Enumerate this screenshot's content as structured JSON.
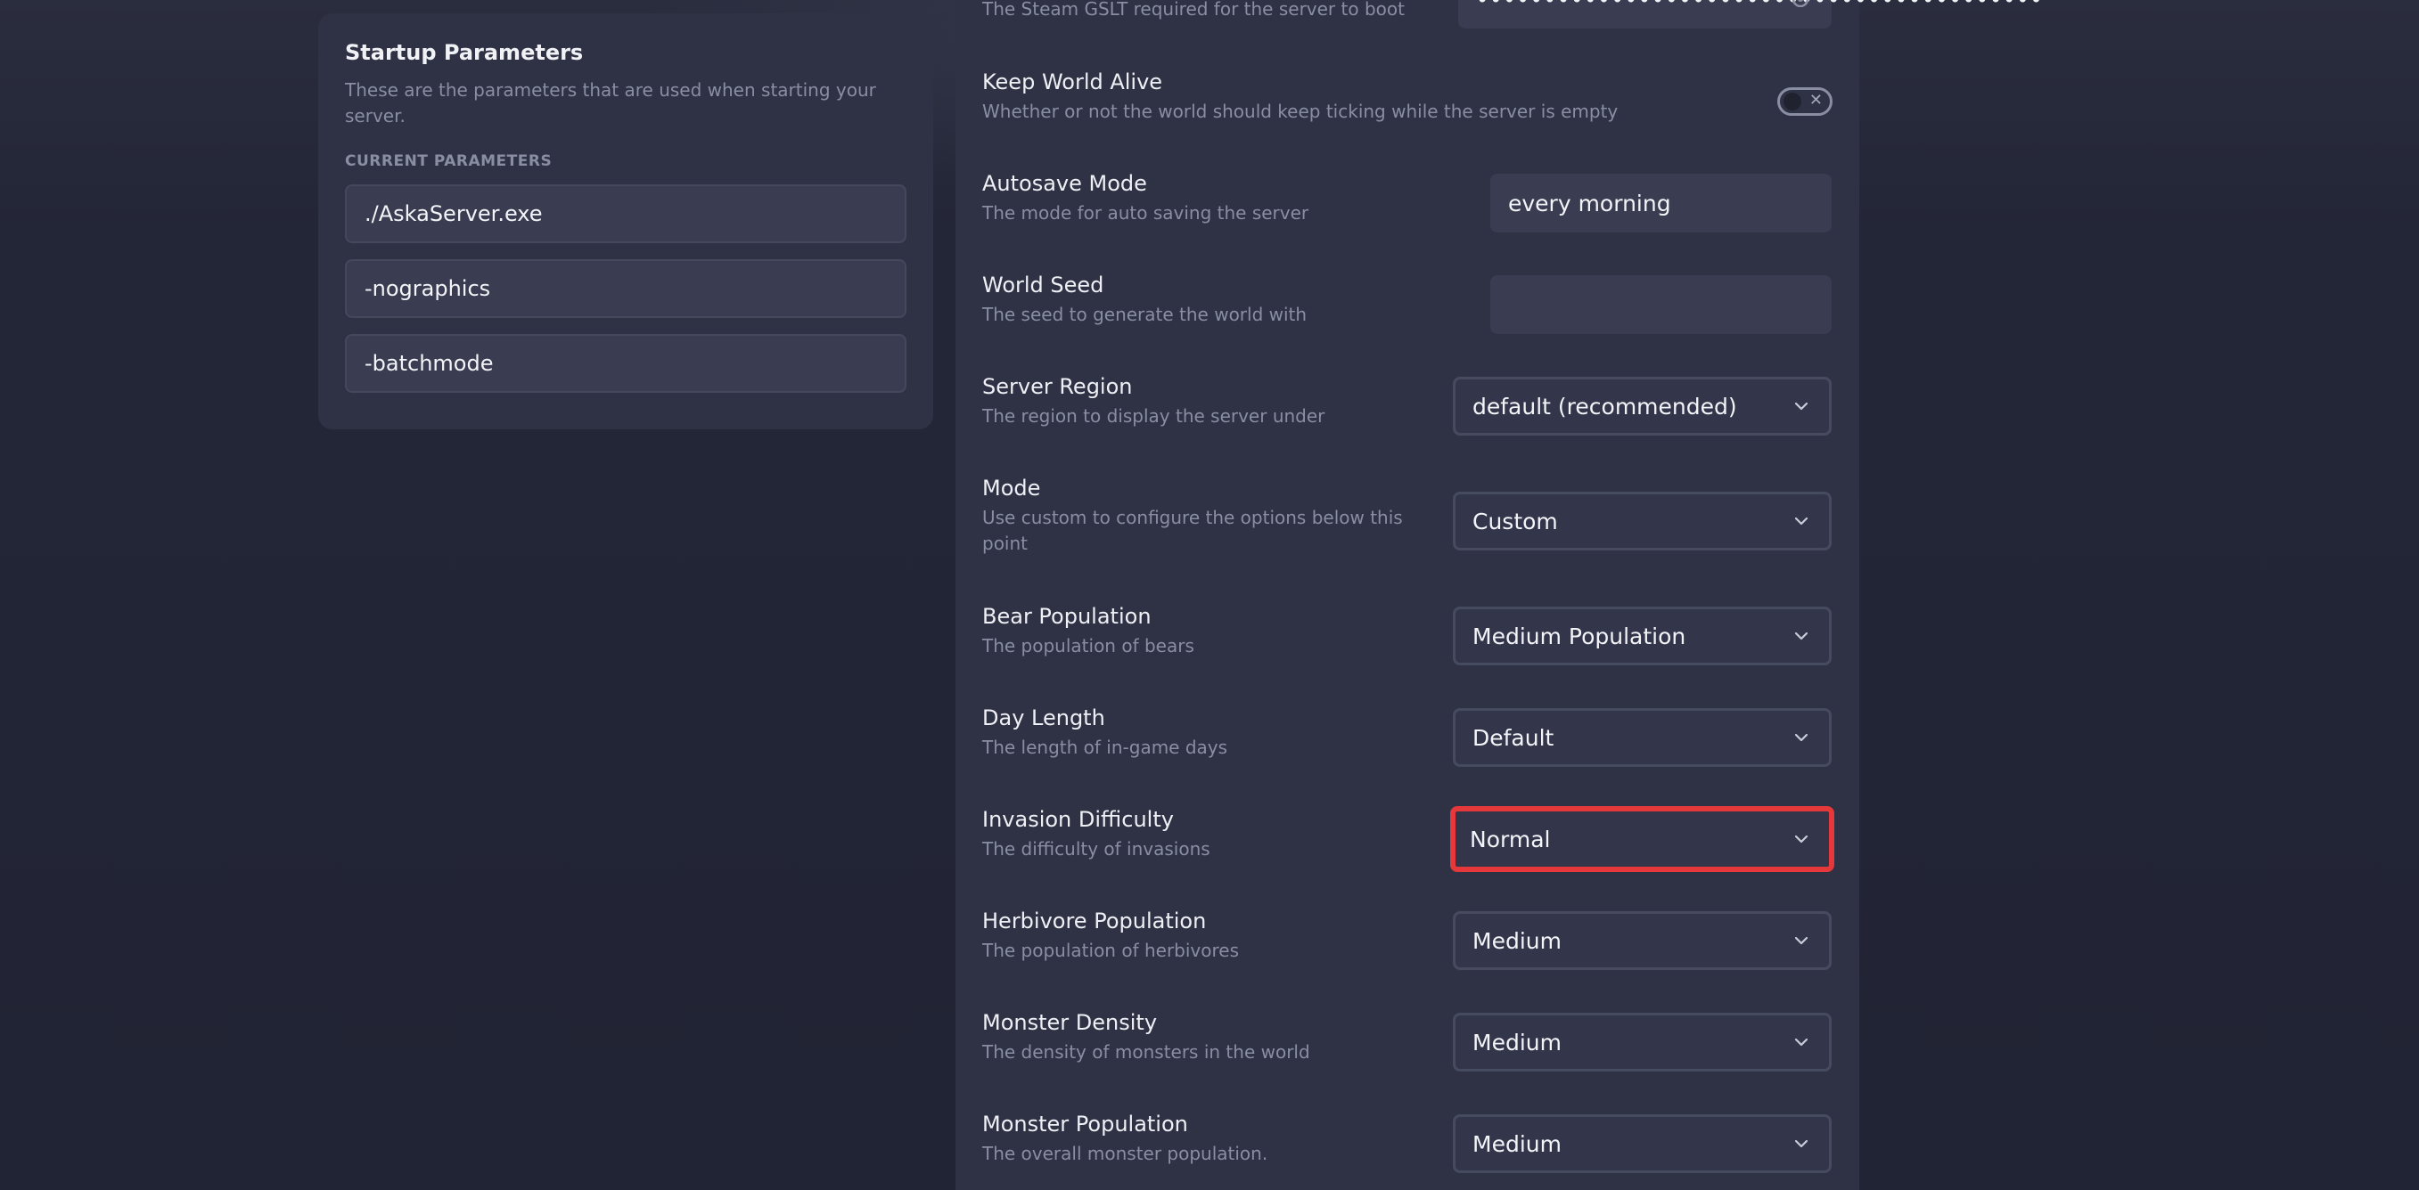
{
  "startup": {
    "title": "Startup Parameters",
    "description": "These are the parameters that are used when starting your server.",
    "current_label": "CURRENT PARAMETERS",
    "params": [
      "./AskaServer.exe",
      "-nographics",
      "-batchmode"
    ]
  },
  "settings": {
    "gslt": {
      "description": "The Steam GSLT required for the server to boot",
      "masked_value": "••••••••••••••••••••••••••••••••••••••••••"
    },
    "keep_world_alive": {
      "title": "Keep World Alive",
      "description": "Whether or not the world should keep ticking while the server is empty",
      "enabled": false
    },
    "autosave_mode": {
      "title": "Autosave Mode",
      "description": "The mode for auto saving the server",
      "value": "every morning"
    },
    "world_seed": {
      "title": "World Seed",
      "description": "The seed to generate the world with",
      "value": ""
    },
    "server_region": {
      "title": "Server Region",
      "description": "The region to display the server under",
      "value": "default (recommended)"
    },
    "mode": {
      "title": "Mode",
      "description": "Use custom to configure the options below this point",
      "value": "Custom"
    },
    "bear_population": {
      "title": "Bear Population",
      "description": "The population of bears",
      "value": "Medium Population"
    },
    "day_length": {
      "title": "Day Length",
      "description": "The length of in-game days",
      "value": "Default"
    },
    "invasion_difficulty": {
      "title": "Invasion Difficulty",
      "description": "The difficulty of invasions",
      "value": "Normal"
    },
    "herbivore_population": {
      "title": "Herbivore Population",
      "description": "The population of herbivores",
      "value": "Medium"
    },
    "monster_density": {
      "title": "Monster Density",
      "description": "The density of monsters in the world",
      "value": "Medium"
    },
    "monster_population": {
      "title": "Monster Population",
      "description": "The overall monster population.",
      "value": "Medium"
    }
  },
  "colors": {
    "highlight": "#e5383b",
    "panel": "#2f3244",
    "background": "#232637"
  }
}
